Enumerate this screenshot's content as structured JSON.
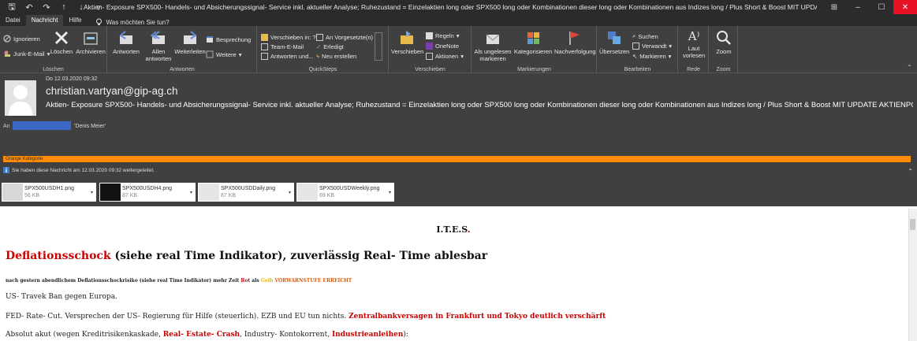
{
  "window": {
    "title": "Aktien- Exposure SPX500- Handels- und Absicherungssignal- Service inkl. aktueller Analyse; Ruhezustand = Einzelaktien long oder SPX500 long oder Kombinationen dieser long oder Kombinationen aus Indizes long / Plus Short & Boost MIT UPDATE AKTIENPORTFO  -  Nachricht (HTML)",
    "controls": {
      "minimize": "–",
      "maximize": "☐",
      "close": "✕",
      "ribbon": "⊞"
    }
  },
  "menu": {
    "items": [
      "Datei",
      "Nachricht",
      "Hilfe"
    ],
    "active": "Nachricht",
    "tell_me": "Was möchten Sie tun?"
  },
  "ribbon": {
    "loeschen": {
      "label": "Löschen",
      "ignorieren": "Ignorieren",
      "junk": "Junk-E-Mail",
      "loeschen_btn": "Löschen",
      "archivieren": "Archivieren"
    },
    "antworten": {
      "label": "Antworten",
      "antworten_btn": "Antworten",
      "allen_1": "Allen",
      "allen_2": "antworten",
      "weiterleiten": "Weiterleiten",
      "besprechung": "Besprechung",
      "weitere": "Weitere"
    },
    "quicksteps": {
      "label": "QuickSteps",
      "items": [
        "Verschieben in: ?",
        "Team-E-Mail",
        "Antworten und...",
        "An Vorgesetzte(n)",
        "Erledigt",
        "Neu erstellen"
      ]
    },
    "verschieben": {
      "label": "Verschieben",
      "verschieben_btn": "Verschieben",
      "regeln": "Regeln",
      "onenote": "OneNote",
      "aktionen": "Aktionen"
    },
    "markierungen": {
      "label": "Markierungen",
      "ungelesen_1": "Als ungelesen",
      "ungelesen_2": "markieren",
      "kategorisieren": "Kategorisieren",
      "nachverfolgung": "Nachverfolgung"
    },
    "bearbeiten": {
      "label": "Bearbeiten",
      "uebersetzen": "Übersetzen",
      "suchen": "Suchen",
      "verwandt": "Verwandt",
      "markieren": "Markieren"
    },
    "rede": {
      "label": "Rede",
      "laut_1": "Laut",
      "laut_2": "vorlesen"
    },
    "zoom": {
      "label": "Zoom",
      "zoom_btn": "Zoom"
    }
  },
  "message": {
    "date": "Do 12.03.2020 09:32",
    "sender": "christian.vartyan@gip-ag.ch",
    "subject": "Aktien- Exposure SPX500- Handels- und Absicherungssignal- Service inkl. aktueller Analyse; Ruhezustand = Einzelaktien long oder SPX500 long oder Kombinationen dieser long oder Kombinationen aus Indizes long / Plus Short & Boost MIT UPDATE AKTIENPORTI",
    "to_label": "An",
    "to_name": "'Denis Meier'",
    "category": "Orange Kategorie",
    "info": "Sie haben diese Nachricht am 12.03.2020 09:32 weitergeleitet."
  },
  "attachments": [
    {
      "name": "SPX500USDH1.png",
      "size": "56 KB"
    },
    {
      "name": "SPX500USDH4.png",
      "size": "87 KB"
    },
    {
      "name": "SPX500USDDaily.png",
      "size": "87 KB"
    },
    {
      "name": "SPX500USDWeekly.png",
      "size": "69 KB"
    }
  ],
  "body": {
    "ites_main": "I.T.E.S",
    "ites_dot": ".",
    "headline_red": "Deflationsschock",
    "headline_rest": " (siehe real Time Indikator), zuverlässig Real- Time ablesbar",
    "small_1": "nach gestern abendlichem Deflationsschockrisiko (siehe real Time Indikator) mehr Zeit ",
    "small_rot": "Rot",
    "small_als": " als ",
    "small_gelb": "Gelb",
    "small_warn": " VORWARNSTUFE ERREICHT",
    "line_1": "US- Travek Ban gegen Europa.",
    "line_2a": "FED- Rate- Cut. Versprechen der US- Regierung für Hilfe (steuerlich). EZB und EU tun nichts. ",
    "line_2b": "Zentralbankversagen in Frankfurt und Tokyo deutlich verschärft",
    "line_3a": "Absolut akut (wegen Kreditrisikenkaskade, ",
    "line_3b": "Real- Estate- Crash",
    "line_3c": ", Industry- Kontokorrent, ",
    "line_3d": "Industrieanleihen",
    "line_3e": "):"
  }
}
